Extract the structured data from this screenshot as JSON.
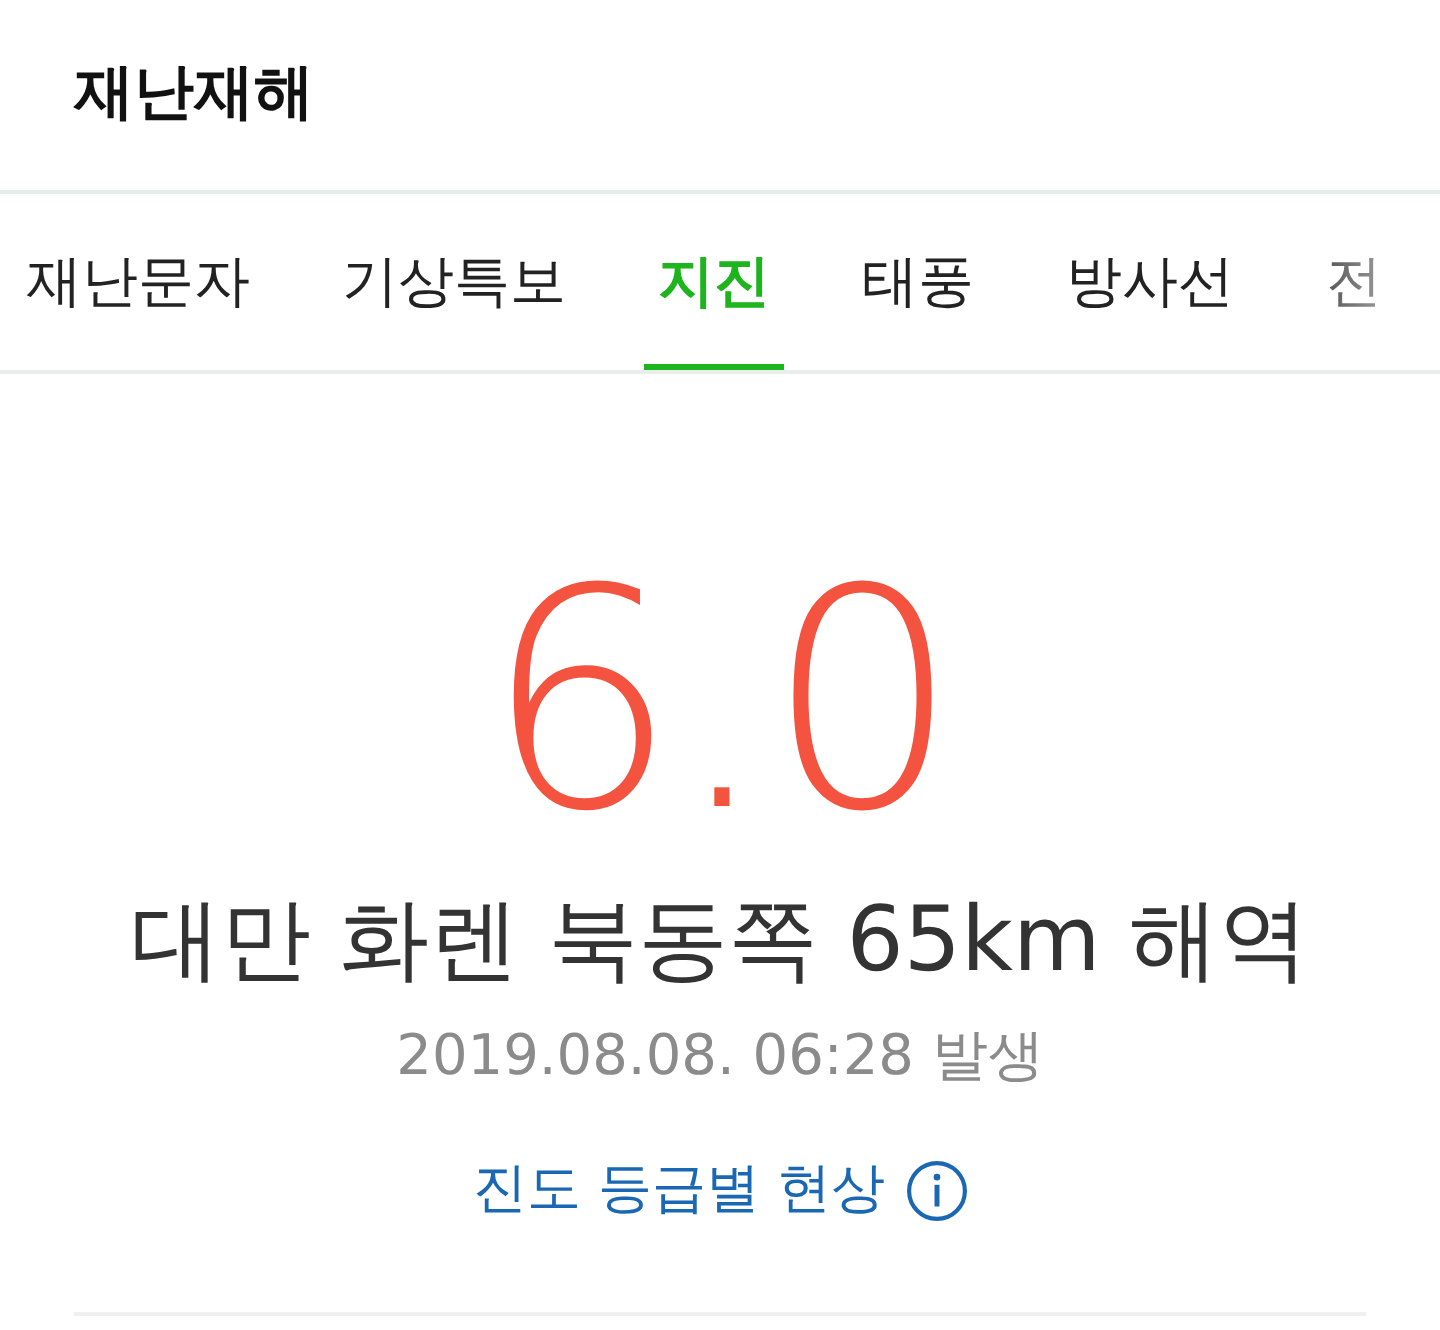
{
  "header": {
    "title": "재난재해"
  },
  "tabs": [
    {
      "label": "재난문자",
      "selected": false
    },
    {
      "label": "기상특보",
      "selected": false
    },
    {
      "label": "지진",
      "selected": true
    },
    {
      "label": "태풍",
      "selected": false
    },
    {
      "label": "방사선",
      "selected": false
    },
    {
      "label": "전",
      "selected": false
    }
  ],
  "earthquake": {
    "magnitude": "6.0",
    "location": "대만 화렌 북동쪽 65km 해역",
    "time": "2019.08.08. 06:28 발생",
    "link": "진도 등급별 현상"
  }
}
